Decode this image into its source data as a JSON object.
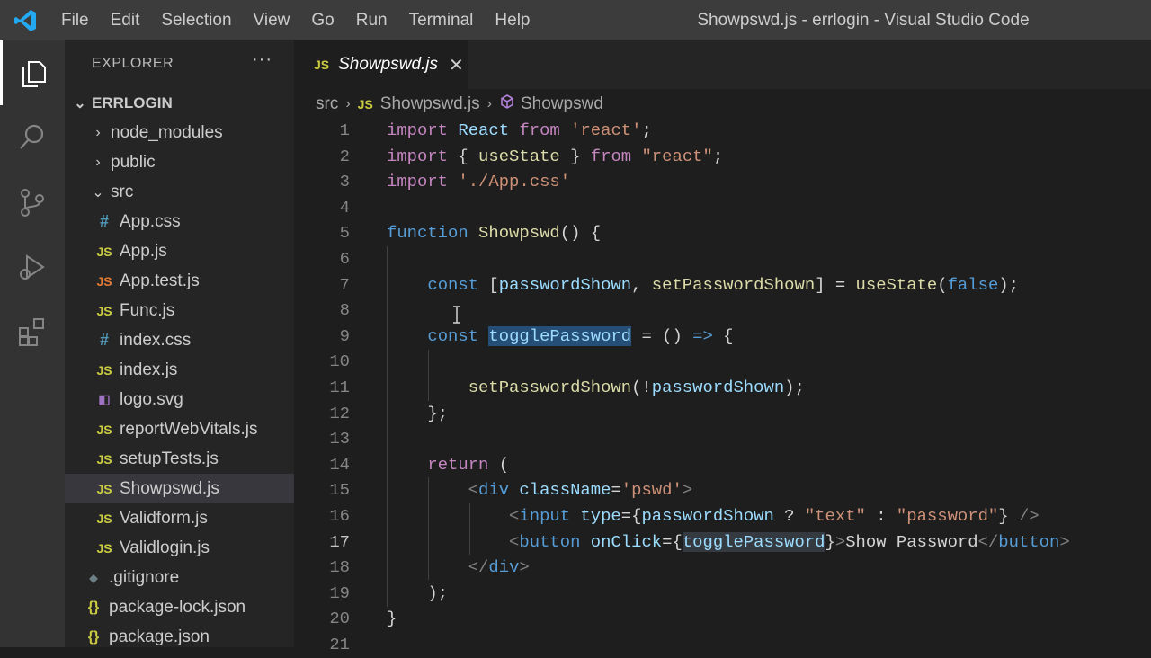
{
  "titlebar": {
    "menu": [
      "File",
      "Edit",
      "Selection",
      "View",
      "Go",
      "Run",
      "Terminal",
      "Help"
    ],
    "window_title": "Showpswd.js - errlogin - Visual Studio Code"
  },
  "sidebar": {
    "title": "EXPLORER",
    "more": "···",
    "root": "ERRLOGIN",
    "items": [
      {
        "label": "node_modules",
        "type": "folder"
      },
      {
        "label": "public",
        "type": "folder"
      },
      {
        "label": "src",
        "type": "folder-open"
      },
      {
        "label": "App.css",
        "type": "css"
      },
      {
        "label": "App.js",
        "type": "js"
      },
      {
        "label": "App.test.js",
        "type": "test"
      },
      {
        "label": "Func.js",
        "type": "js"
      },
      {
        "label": "index.css",
        "type": "css"
      },
      {
        "label": "index.js",
        "type": "js"
      },
      {
        "label": "logo.svg",
        "type": "svg"
      },
      {
        "label": "reportWebVitals.js",
        "type": "js"
      },
      {
        "label": "setupTests.js",
        "type": "js"
      },
      {
        "label": "Showpswd.js",
        "type": "js",
        "selected": true
      },
      {
        "label": "Validform.js",
        "type": "js"
      },
      {
        "label": "Validlogin.js",
        "type": "js"
      },
      {
        "label": ".gitignore",
        "type": "git"
      },
      {
        "label": "package-lock.json",
        "type": "json"
      },
      {
        "label": "package.json",
        "type": "json"
      }
    ]
  },
  "editor": {
    "tab_label": "Showpswd.js",
    "tab_close": "✕",
    "badge": "JS",
    "breadcrumb": [
      "src",
      "Showpswd.js",
      "Showpswd"
    ],
    "line_numbers": [
      "1",
      "2",
      "3",
      "4",
      "5",
      "6",
      "7",
      "8",
      "9",
      "10",
      "11",
      "12",
      "13",
      "14",
      "15",
      "16",
      "17",
      "18",
      "19",
      "20",
      "21"
    ],
    "lines": [
      "import React from 'react';",
      "import { useState } from \"react\";",
      "import './App.css'",
      "",
      "function Showpswd() {",
      "",
      "    const [passwordShown, setPasswordShown] = useState(false);",
      "",
      "    const togglePassword = () => {",
      "",
      "        setPasswordShown(!passwordShown);",
      "    };",
      "",
      "    return (",
      "        <div className='pswd'>",
      "            <input type={passwordShown ? \"text\" : \"password\"} />",
      "            <button onClick={togglePassword}>Show Password</button>",
      "        </div>",
      "    );",
      "}",
      ""
    ],
    "current_line": 17
  },
  "colors": {
    "keyword_control": "#c586c0",
    "keyword": "#569cd6",
    "string": "#ce9178",
    "variable": "#9cdcfe",
    "function": "#dcdcaa",
    "selection": "#264f78"
  },
  "icons": {
    "activity": [
      "explorer-icon",
      "search-icon",
      "source-control-icon",
      "run-debug-icon",
      "extensions-icon"
    ]
  }
}
